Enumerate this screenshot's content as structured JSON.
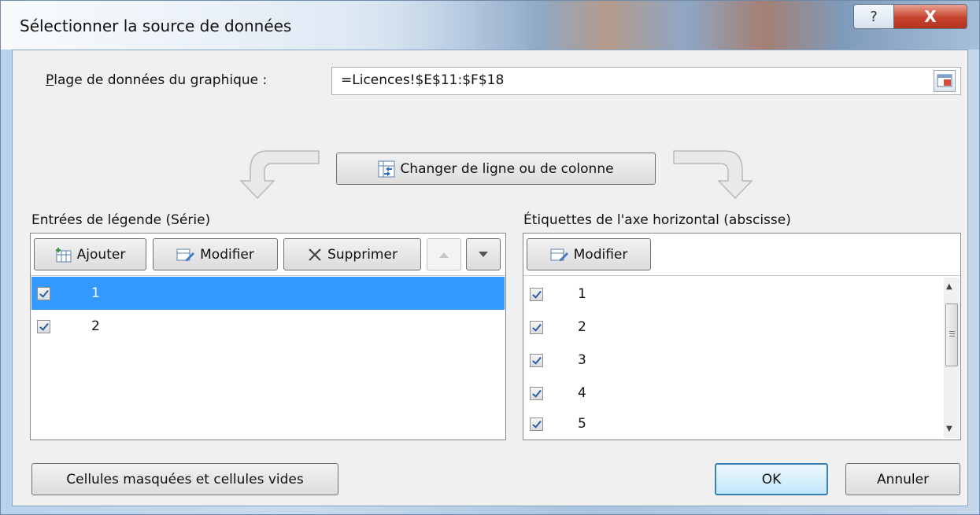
{
  "window": {
    "title": "Sélectionner la source de données",
    "help_label": "?",
    "close_label": "X"
  },
  "range": {
    "label": "Plage de données du graphique :",
    "value": "=Licences!$E$11:$F$18"
  },
  "switch_button_label": "Changer de ligne ou de colonne",
  "legend": {
    "heading": "Entrées de légende (Série)",
    "add_label": "Ajouter",
    "edit_label": "Modifier",
    "delete_label": "Supprimer",
    "items": [
      {
        "label": "1",
        "checked": true,
        "selected": true
      },
      {
        "label": "2",
        "checked": true,
        "selected": false
      }
    ]
  },
  "axis": {
    "heading": "Étiquettes de l'axe horizontal (abscisse)",
    "edit_label": "Modifier",
    "items": [
      {
        "label": "1",
        "checked": true
      },
      {
        "label": "2",
        "checked": true
      },
      {
        "label": "3",
        "checked": true
      },
      {
        "label": "4",
        "checked": true
      },
      {
        "label": "5",
        "checked": true
      }
    ]
  },
  "footer": {
    "hidden_cells_label": "Cellules masquées et cellules vides",
    "ok_label": "OK",
    "cancel_label": "Annuler"
  },
  "colors": {
    "selection": "#3399ff",
    "primary_border": "#3c7fb1",
    "close_red": "#c6442e"
  }
}
